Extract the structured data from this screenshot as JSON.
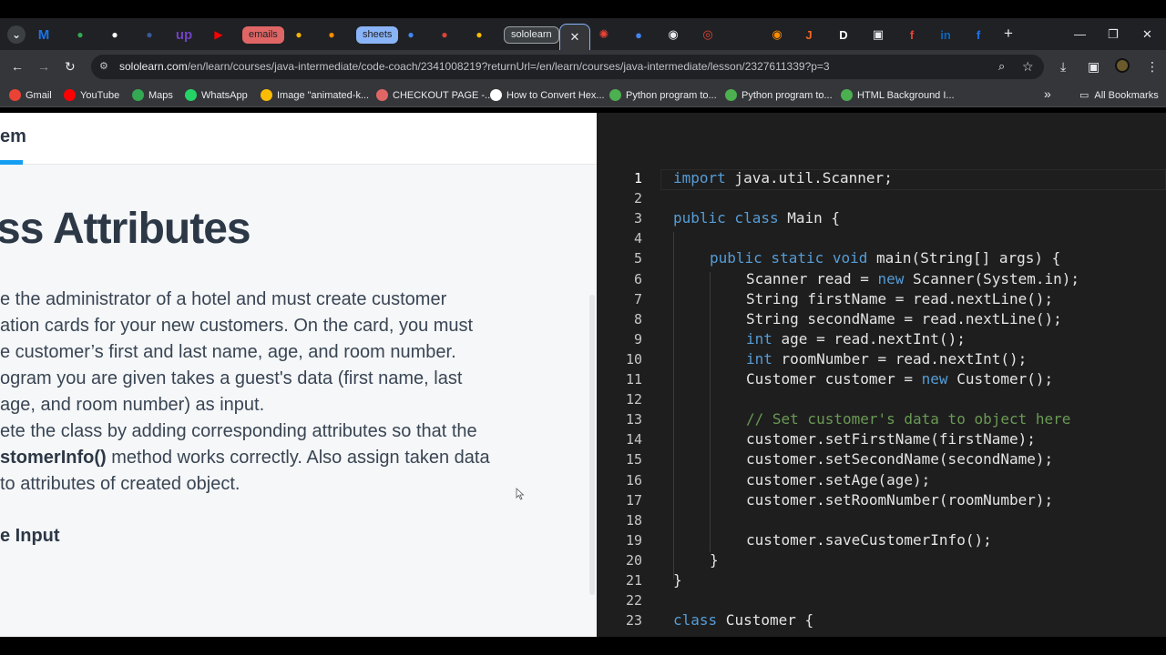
{
  "browser": {
    "tabs": [
      {
        "label": "",
        "icon": "chevron-down-icon",
        "color": "#5f6368"
      },
      {
        "label": "M",
        "icon": "gmail-m-icon",
        "color": "#1a73e8"
      },
      {
        "label": "",
        "icon": "play-arrow-icon",
        "color": "#34a853"
      },
      {
        "label": "",
        "icon": "circle-play-icon",
        "color": "#ffffff"
      },
      {
        "label": "",
        "icon": "w-icon",
        "color": "#3b5998"
      },
      {
        "label": "up",
        "icon": "upwork-icon",
        "color": "#6f42c1"
      },
      {
        "label": "",
        "icon": "youtube-icon",
        "color": "#ff0000"
      },
      {
        "label": "emails",
        "icon": "",
        "color": "#e06666"
      },
      {
        "label": "",
        "icon": "pin-icon",
        "color": "#f4b400"
      },
      {
        "label": "",
        "icon": "ring-icon",
        "color": "#ff8c00"
      },
      {
        "label": "sheets",
        "icon": "",
        "color": "#8ab4f8"
      },
      {
        "label": "",
        "icon": "doc-icon",
        "color": "#4285f4"
      },
      {
        "label": "",
        "icon": "red-doc-icon",
        "color": "#db4437"
      },
      {
        "label": "",
        "icon": "pencil-icon",
        "color": "#fbbc04"
      },
      {
        "label": "sololearn",
        "icon": "",
        "color": "#3c4043"
      }
    ],
    "active_tab_close": "✕",
    "tabs_right_icons": [
      "pinwheel-icon",
      "planet-icon",
      "chat-icon",
      "circle-icon",
      "blank-icon",
      "orange-circle-icon",
      "j-icon",
      "d-icon",
      "box-icon",
      "r-icon",
      "linkedin-icon",
      "facebook-icon"
    ],
    "new_tab": "+",
    "window_controls": {
      "minimize": "—",
      "restore": "❐",
      "close": "✕"
    },
    "url_host": "sololearn.com",
    "url_path": "/en/learn/courses/java-intermediate/code-coach/2341008219?returnUrl=/en/learn/courses/java-intermediate/lesson/2327611339?p=3",
    "bookmarks": [
      {
        "label": "Gmail",
        "color": "#ea4335"
      },
      {
        "label": "YouTube",
        "color": "#ff0000"
      },
      {
        "label": "Maps",
        "color": "#34a853"
      },
      {
        "label": "WhatsApp",
        "color": "#25d366"
      },
      {
        "label": "Image \"animated-k...",
        "color": "#fbbc04"
      },
      {
        "label": "CHECKOUT PAGE -...",
        "color": "#e06666"
      },
      {
        "label": "How to Convert Hex...",
        "color": "#ffffff"
      },
      {
        "label": "Python program to...",
        "color": "#4caf50"
      },
      {
        "label": "Python program to...",
        "color": "#4caf50"
      },
      {
        "label": "HTML Background I...",
        "color": "#4caf50"
      }
    ],
    "bookmarks_more": "»",
    "all_bookmarks": "All Bookmarks"
  },
  "lesson": {
    "tab_label": "em",
    "title": "ss Attributes",
    "paragraph_lines": [
      "e the administrator of a hotel and must create customer",
      "ation cards for your new customers. On the card, you must",
      "e customer’s first and last name, age, and room number.",
      "ogram you are given takes a guest's data (first name, last",
      "age, and room number) as input.",
      "ete the class by adding corresponding attributes so that the"
    ],
    "line7_bold": "stomerInfo()",
    "line7_rest": " method works correctly. Also assign taken data",
    "line8": "to attributes of created object.",
    "subheading": "e Input"
  },
  "editor": {
    "lines": [
      {
        "n": "1",
        "indent": 0,
        "parts": [
          [
            "k",
            "import"
          ],
          [
            "t",
            " java.util.Scanner;"
          ]
        ]
      },
      {
        "n": "2",
        "indent": 0,
        "parts": []
      },
      {
        "n": "3",
        "indent": 0,
        "parts": [
          [
            "k",
            "public class"
          ],
          [
            "t",
            " Main {"
          ]
        ]
      },
      {
        "n": "4",
        "indent": 0,
        "parts": []
      },
      {
        "n": "5",
        "indent": 1,
        "parts": [
          [
            "k",
            "public static void"
          ],
          [
            "t",
            " main(String[] args) {"
          ]
        ]
      },
      {
        "n": "6",
        "indent": 2,
        "parts": [
          [
            "t",
            "Scanner read = "
          ],
          [
            "k",
            "new"
          ],
          [
            "t",
            " Scanner(System.in);"
          ]
        ]
      },
      {
        "n": "7",
        "indent": 2,
        "parts": [
          [
            "t",
            "String firstName = read.nextLine();"
          ]
        ]
      },
      {
        "n": "8",
        "indent": 2,
        "parts": [
          [
            "t",
            "String secondName = read.nextLine();"
          ]
        ]
      },
      {
        "n": "9",
        "indent": 2,
        "parts": [
          [
            "k",
            "int"
          ],
          [
            "t",
            " age = read.nextInt();"
          ]
        ]
      },
      {
        "n": "10",
        "indent": 2,
        "parts": [
          [
            "k",
            "int"
          ],
          [
            "t",
            " roomNumber = read.nextInt();"
          ]
        ]
      },
      {
        "n": "11",
        "indent": 2,
        "parts": [
          [
            "t",
            "Customer customer = "
          ],
          [
            "k",
            "new"
          ],
          [
            "t",
            " Customer();"
          ]
        ]
      },
      {
        "n": "12",
        "indent": 0,
        "parts": []
      },
      {
        "n": "13",
        "indent": 2,
        "parts": [
          [
            "c",
            "// Set customer's data to object here"
          ]
        ]
      },
      {
        "n": "14",
        "indent": 2,
        "parts": [
          [
            "t",
            "customer.setFirstName(firstName);"
          ]
        ]
      },
      {
        "n": "15",
        "indent": 2,
        "parts": [
          [
            "t",
            "customer.setSecondName(secondName);"
          ]
        ]
      },
      {
        "n": "16",
        "indent": 2,
        "parts": [
          [
            "t",
            "customer.setAge(age);"
          ]
        ]
      },
      {
        "n": "17",
        "indent": 2,
        "parts": [
          [
            "t",
            "customer.setRoomNumber(roomNumber);"
          ]
        ]
      },
      {
        "n": "18",
        "indent": 0,
        "parts": []
      },
      {
        "n": "19",
        "indent": 2,
        "parts": [
          [
            "t",
            "customer.saveCustomerInfo();"
          ]
        ]
      },
      {
        "n": "20",
        "indent": 1,
        "parts": [
          [
            "t",
            "}"
          ]
        ]
      },
      {
        "n": "21",
        "indent": 0,
        "parts": [
          [
            "t",
            "}"
          ]
        ]
      },
      {
        "n": "22",
        "indent": 0,
        "parts": []
      },
      {
        "n": "23",
        "indent": 0,
        "parts": [
          [
            "k",
            "class"
          ],
          [
            "t",
            " Customer {"
          ]
        ]
      }
    ]
  }
}
